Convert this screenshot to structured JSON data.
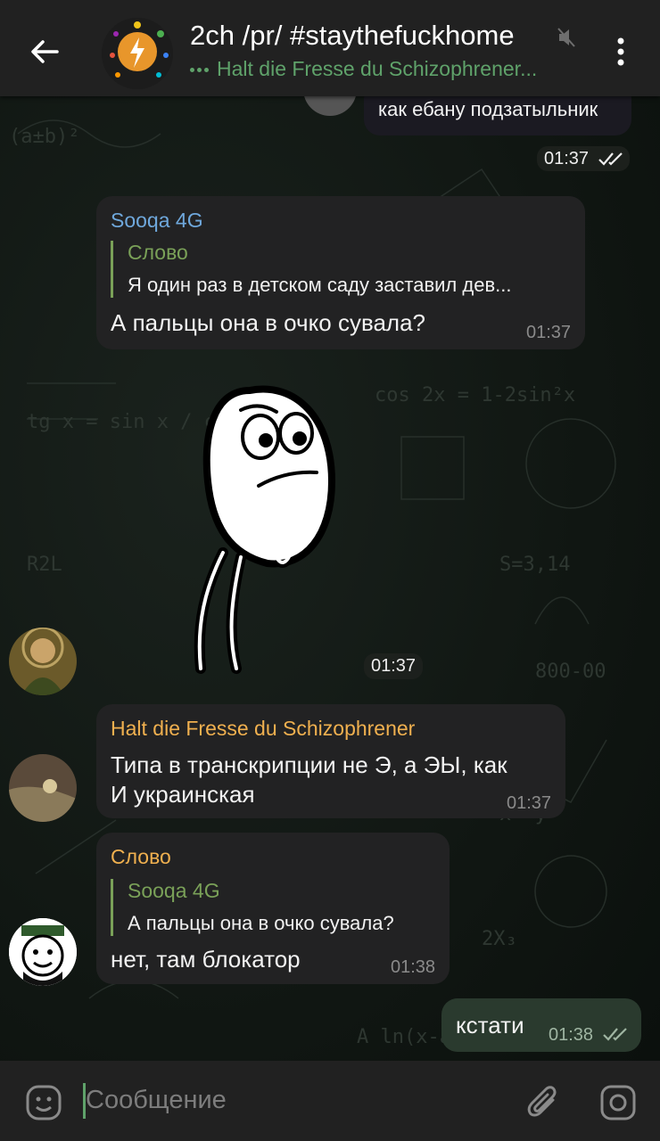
{
  "header": {
    "title": "2ch /pr/ #staythefuckhome",
    "subtitle": "Halt die Fresse du Schizophrener...",
    "avatar_label": "/PR/"
  },
  "messages": {
    "top_partial": {
      "text": "как ебану подзатыльник",
      "time": "01:37"
    },
    "m1": {
      "sender": "Sooqa 4G",
      "reply_name": "Слово",
      "reply_text": "Я один раз в детском саду заставил дев...",
      "text": "А пальцы она в очко сувала?",
      "time": "01:37"
    },
    "sticker": {
      "time": "01:37"
    },
    "m2": {
      "sender": "Halt die Fresse du Schizophrener",
      "line1": "Типа в транскрипции не Э, а ЭЫ, как",
      "line2": "И украинская",
      "time": "01:37"
    },
    "m3": {
      "sender": "Слово",
      "reply_name": "Sooqa 4G",
      "reply_text": "А пальцы она в очко сувала?",
      "text": "нет, там блокатор",
      "time": "01:38"
    },
    "m4": {
      "text": "кстати",
      "time": "01:38"
    }
  },
  "input": {
    "placeholder": "Сообщение"
  },
  "colors": {
    "accent": "#5fa26a",
    "sooqa_name": "#6fa8dc",
    "halt_name": "#f0b04f",
    "slovo_name": "#f0b04f",
    "reply_bar": "#7aa158"
  }
}
